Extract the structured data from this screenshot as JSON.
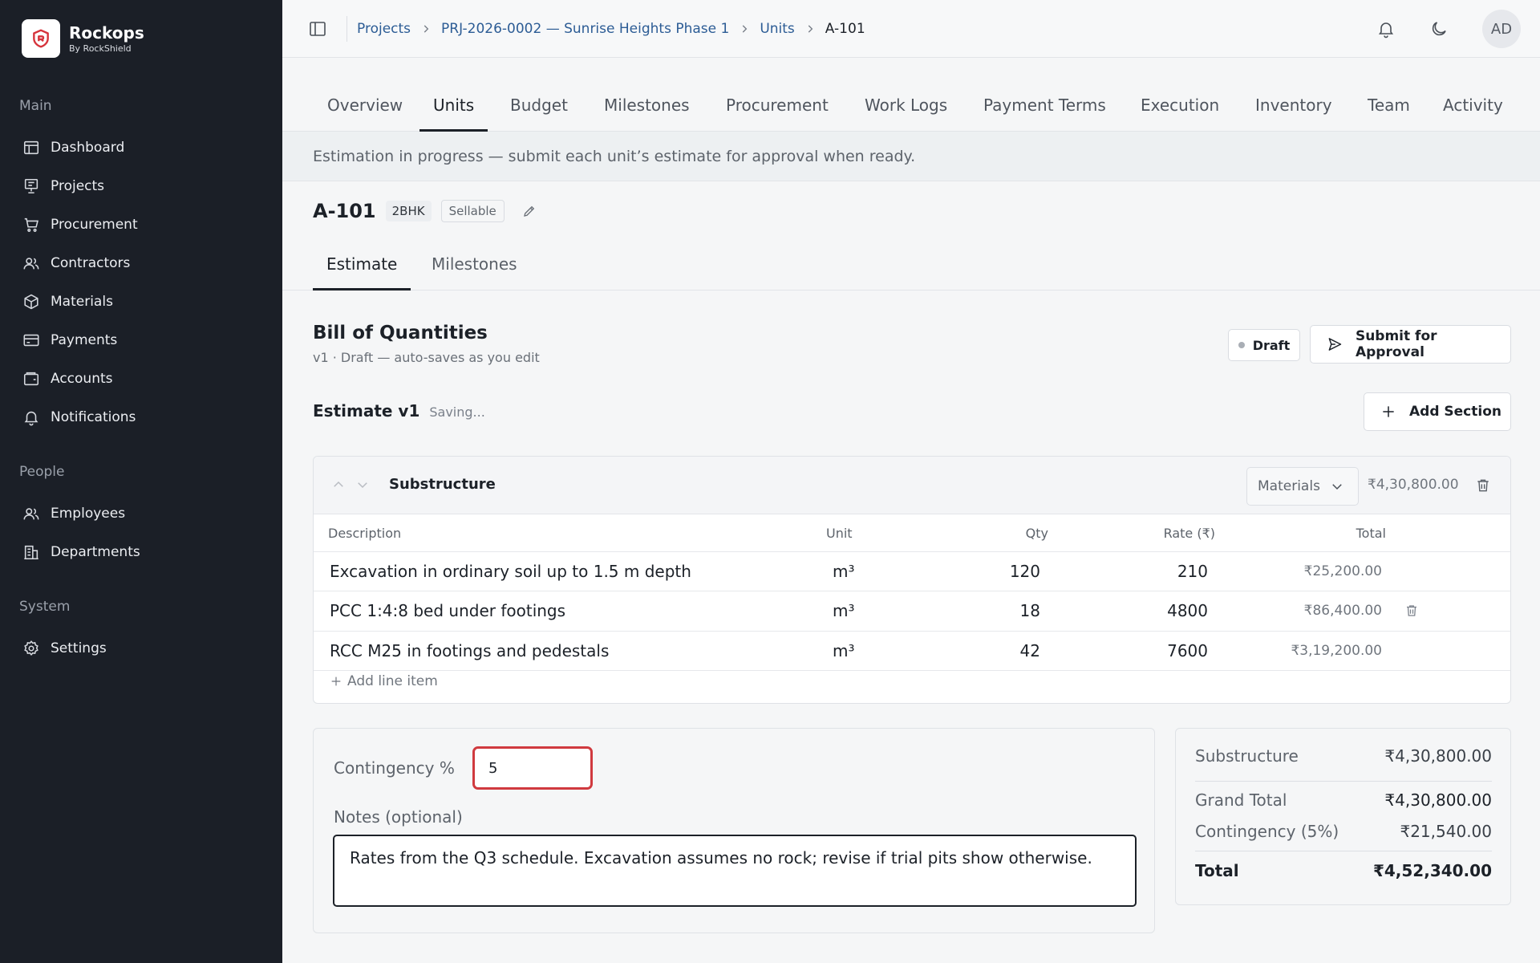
{
  "brand": {
    "name": "Rockops",
    "sub": "By RockShield"
  },
  "sidebar": {
    "groups": [
      {
        "heading": "Main",
        "items": [
          {
            "label": "Dashboard",
            "icon": "dashboard-icon"
          },
          {
            "label": "Projects",
            "icon": "projects-icon"
          },
          {
            "label": "Procurement",
            "icon": "cart-icon"
          },
          {
            "label": "Contractors",
            "icon": "users-icon"
          },
          {
            "label": "Materials",
            "icon": "box-icon"
          },
          {
            "label": "Payments",
            "icon": "card-icon"
          },
          {
            "label": "Accounts",
            "icon": "wallet-icon"
          },
          {
            "label": "Notifications",
            "icon": "bell-icon"
          }
        ]
      },
      {
        "heading": "People",
        "items": [
          {
            "label": "Employees",
            "icon": "users-icon"
          },
          {
            "label": "Departments",
            "icon": "building-icon"
          }
        ]
      },
      {
        "heading": "System",
        "items": [
          {
            "label": "Settings",
            "icon": "gear-icon"
          }
        ]
      }
    ]
  },
  "header": {
    "breadcrumb": [
      "Projects",
      "PRJ-2026-0002 — Sunrise Heights Phase 1",
      "Units",
      "A-101"
    ],
    "avatar": "AD"
  },
  "tabs": [
    "Overview",
    "Units",
    "Budget",
    "Milestones",
    "Procurement",
    "Work Logs",
    "Payment Terms",
    "Execution",
    "Inventory",
    "Team",
    "Activity"
  ],
  "active_tab": "Units",
  "banner": "Estimation in progress — submit each unit’s estimate for approval when ready.",
  "unit": {
    "title": "A-101",
    "type": "2BHK",
    "status": "Sellable"
  },
  "subtabs": [
    "Estimate",
    "Milestones"
  ],
  "boq": {
    "title": "Bill of Quantities",
    "subtitle": "v1 · Draft — auto-saves as you edit",
    "draft_label": "Draft",
    "submit_label": "Submit for Approval"
  },
  "estimate": {
    "title": "Estimate v1",
    "status": "Saving...",
    "add_section_label": "Add Section"
  },
  "section": {
    "name": "Substructure",
    "category": "Materials",
    "total": "₹4,30,800.00",
    "columns": [
      "Description",
      "Unit",
      "Qty",
      "Rate (₹)",
      "Total"
    ],
    "rows": [
      {
        "description": "Excavation in ordinary soil up to 1.5 m depth",
        "unit": "m³",
        "qty": "120",
        "rate": "210",
        "total": "₹25,200.00"
      },
      {
        "description": "PCC 1:4:8 bed under footings",
        "unit": "m³",
        "qty": "18",
        "rate": "4800",
        "total": "₹86,400.00"
      },
      {
        "description": "RCC M25 in footings and pedestals",
        "unit": "m³",
        "qty": "42",
        "rate": "7600",
        "total": "₹3,19,200.00"
      }
    ],
    "add_line_label": "Add line item"
  },
  "form": {
    "contingency_label": "Contingency %",
    "contingency_value": "5",
    "notes_label": "Notes (optional)",
    "notes_value": "Rates from the Q3 schedule. Excavation assumes no rock; revise if trial pits show otherwise."
  },
  "summary": {
    "rows": [
      {
        "label": "Substructure",
        "value": "₹4,30,800.00"
      },
      {
        "label": "Grand Total",
        "value": "₹4,30,800.00"
      },
      {
        "label": "Contingency (5%)",
        "value": "₹21,540.00"
      },
      {
        "label": "Total",
        "value": "₹4,52,340.00"
      }
    ]
  }
}
